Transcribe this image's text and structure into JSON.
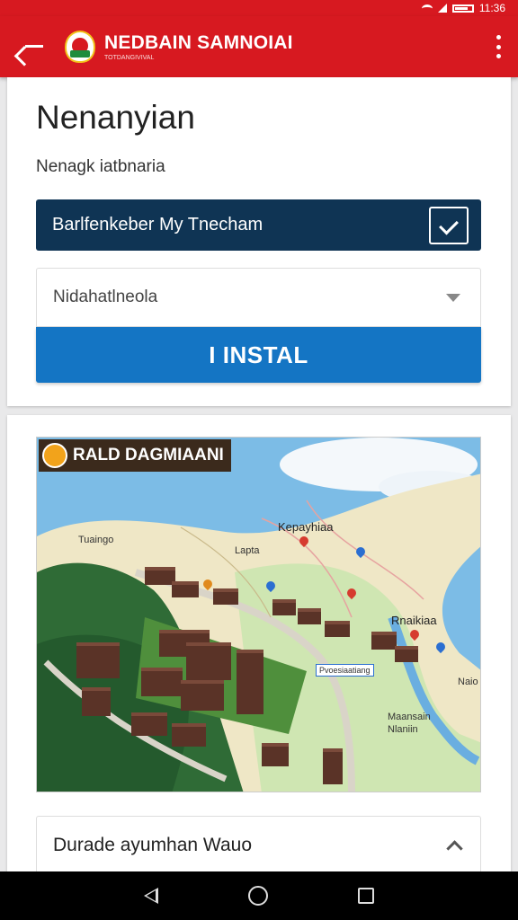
{
  "status_bar": {
    "time": "11:36"
  },
  "app_bar": {
    "title": "NEDBAIN SAMNOIAI",
    "subtitle": "TOTDANGIVIVAL"
  },
  "card": {
    "title": "Nenanyian",
    "subtitle": "Nenagk iatbnaria",
    "option_label": "Barlfenkeber My Tnecham",
    "option_checked": true,
    "select_value": "Nidahatlneola",
    "install_label": "I INSTAL"
  },
  "map": {
    "badge_text": "RALD DAGMIAANI",
    "labels": {
      "top": "Kepayhiaa",
      "left": "Tuaingo",
      "mid": "Lapta",
      "right": "Rnaikiaa",
      "far_right": "Naio",
      "bottom_right": "Maansain\nNlaniin",
      "station": "Pvoesiaatiang"
    }
  },
  "collapse": {
    "label": "Durade ayumhan Wauo"
  },
  "colors": {
    "app_bar": "#d71920",
    "dark_row": "#0f3454",
    "install_button": "#1475c4"
  }
}
